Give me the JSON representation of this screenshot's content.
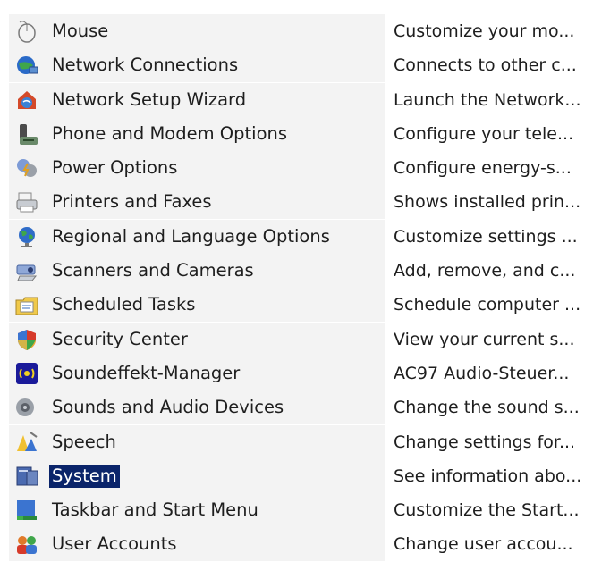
{
  "items": [
    {
      "name": "Mouse",
      "desc": "Customize your mo...",
      "icon": "mouse-icon"
    },
    {
      "name": "Network Connections",
      "desc": "Connects to other c...",
      "icon": "network-connections-icon"
    },
    {
      "name": "Network Setup Wizard",
      "desc": "Launch the Network...",
      "icon": "network-setup-wizard-icon"
    },
    {
      "name": "Phone and Modem Options",
      "desc": "Configure your tele...",
      "icon": "phone-modem-icon"
    },
    {
      "name": "Power Options",
      "desc": "Configure energy-s...",
      "icon": "power-options-icon"
    },
    {
      "name": "Printers and Faxes",
      "desc": "Shows installed prin...",
      "icon": "printers-faxes-icon"
    },
    {
      "name": "Regional and Language Options",
      "desc": "Customize settings ...",
      "icon": "globe-icon"
    },
    {
      "name": "Scanners and Cameras",
      "desc": "Add, remove, and c...",
      "icon": "scanner-camera-icon"
    },
    {
      "name": "Scheduled Tasks",
      "desc": "Schedule computer ...",
      "icon": "scheduled-tasks-icon"
    },
    {
      "name": "Security Center",
      "desc": "View your current s...",
      "icon": "security-shield-icon"
    },
    {
      "name": "Soundeffekt-Manager",
      "desc": "AC97 Audio-Steuer...",
      "icon": "sound-effect-manager-icon"
    },
    {
      "name": "Sounds and Audio Devices",
      "desc": "Change the sound s...",
      "icon": "speaker-icon"
    },
    {
      "name": "Speech",
      "desc": "Change settings for...",
      "icon": "speech-icon"
    },
    {
      "name": "System",
      "desc": "See information abo...",
      "icon": "system-computer-icon",
      "selected": true
    },
    {
      "name": "Taskbar and Start Menu",
      "desc": "Customize the Start...",
      "icon": "taskbar-start-menu-icon"
    },
    {
      "name": "User Accounts",
      "desc": "Change user accou...",
      "icon": "user-accounts-icon"
    }
  ],
  "colors": {
    "selection_bg": "#0a246a",
    "selection_text": "#ffffff",
    "name_column_bg": "#f3f3f3"
  }
}
